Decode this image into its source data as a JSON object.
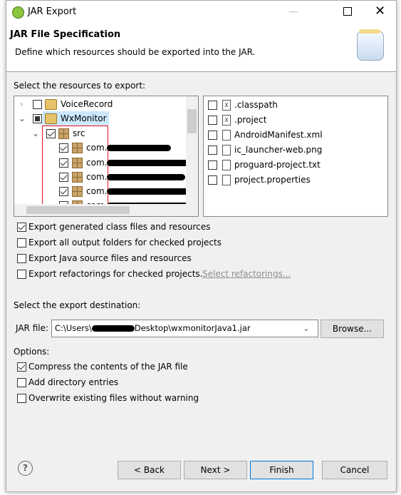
{
  "window": {
    "title": "JAR Export"
  },
  "header": {
    "title": "JAR File Specification",
    "description": "Define which resources should be exported into the JAR."
  },
  "resources": {
    "label": "Select the resources to export:",
    "tree": [
      {
        "label": "VoiceRecord",
        "state": "unchecked",
        "expanded": false
      },
      {
        "label": "WxMonitor",
        "state": "partial",
        "expanded": true,
        "selected": true
      },
      {
        "label": "src",
        "state": "checked",
        "expanded": true
      },
      {
        "label": "com.",
        "state": "checked"
      },
      {
        "label": "com.",
        "state": "checked"
      },
      {
        "label": "com.",
        "state": "checked"
      },
      {
        "label": "com.",
        "state": "checked"
      },
      {
        "label": "com.",
        "state": "checked"
      }
    ],
    "files": [
      {
        "label": ".classpath",
        "checked": false
      },
      {
        "label": ".project",
        "checked": false
      },
      {
        "label": "AndroidManifest.xml",
        "checked": false
      },
      {
        "label": "ic_launcher-web.png",
        "checked": false
      },
      {
        "label": "proguard-project.txt",
        "checked": false
      },
      {
        "label": "project.properties",
        "checked": false
      }
    ]
  },
  "options1": [
    {
      "label": "Export generated class files and resources",
      "checked": true
    },
    {
      "label": "Export all output folders for checked projects",
      "checked": false
    },
    {
      "label": "Export Java source files and resources",
      "checked": false
    },
    {
      "label": "Export refactorings for checked projects.",
      "checked": false
    }
  ],
  "select_refactorings": "Select refactorings...",
  "destination": {
    "label": "Select the export destination:",
    "jar_label": "JAR file:",
    "path_prefix": "C:\\Users\\",
    "path_suffix": "Desktop\\wxmonitorJava1.jar",
    "browse": "Browse..."
  },
  "options": {
    "label": "Options:",
    "items": [
      {
        "label": "Compress the contents of the JAR file",
        "checked": true
      },
      {
        "label": "Add directory entries",
        "checked": false
      },
      {
        "label": "Overwrite existing files without warning",
        "checked": false
      }
    ]
  },
  "buttons": {
    "back": "< Back",
    "next": "Next >",
    "finish": "Finish",
    "cancel": "Cancel",
    "help": "?"
  },
  "colors": {
    "selection": "#cce8ff",
    "highlight_box": "#e81123",
    "link": "#8c8c8c"
  }
}
